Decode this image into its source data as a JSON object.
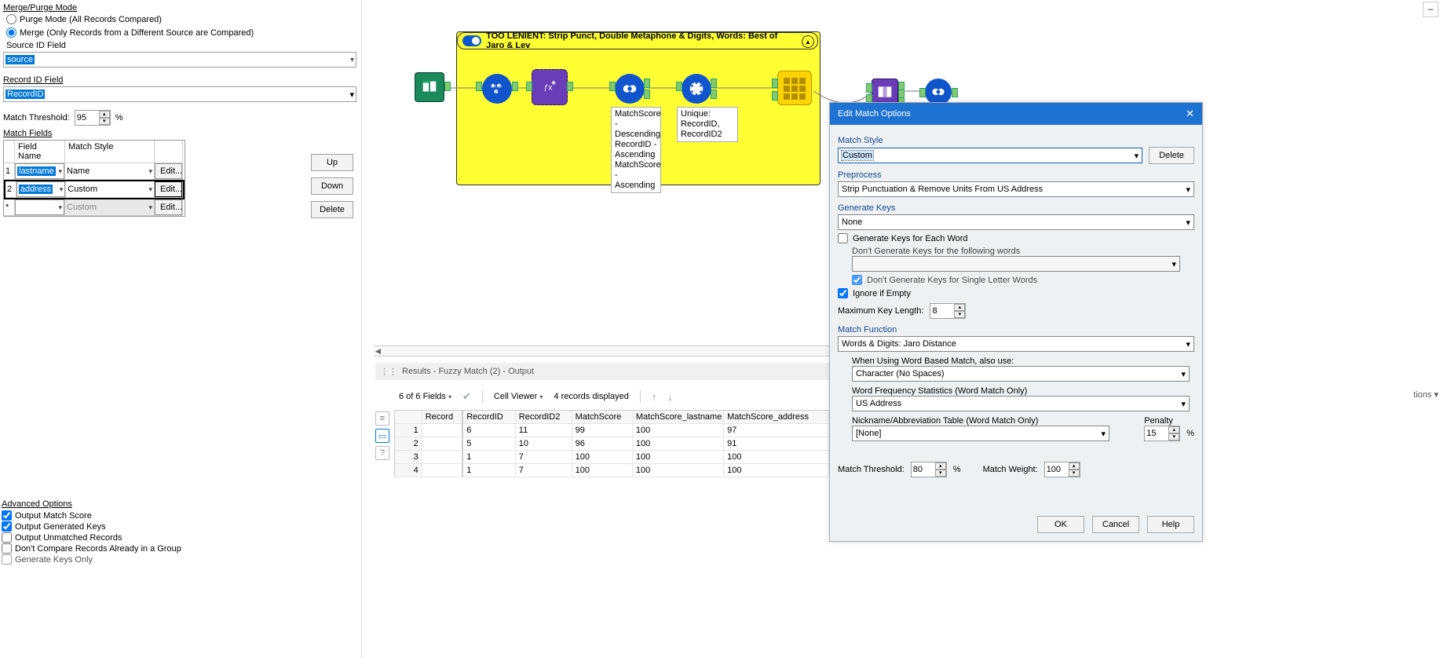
{
  "left": {
    "merge_purge_label": "Merge/Purge Mode",
    "purge_label": "Purge Mode (All Records Compared)",
    "merge_label": "Merge (Only Records from a Different Source are Compared)",
    "source_id_label": "Source ID Field",
    "source_id_value": "source",
    "record_id_label": "Record ID Field",
    "record_id_value": "RecordID",
    "thresh_label": "Match Threshold:",
    "thresh_value": "95",
    "pct": "%",
    "match_fields_label": "Match Fields",
    "headers": {
      "fname": "Field Name",
      "mstyle": "Match Style"
    },
    "rows": [
      {
        "idx": "1",
        "name": "lastname",
        "style": "Name",
        "edit": "Edit..."
      },
      {
        "idx": "2",
        "name": "address",
        "style": "Custom",
        "edit": "Edit..."
      },
      {
        "idx": "*",
        "name": "",
        "style": "Custom",
        "edit": "Edit..."
      }
    ],
    "btns": {
      "up": "Up",
      "down": "Down",
      "delete": "Delete"
    },
    "adv_label": "Advanced Options",
    "adv": {
      "out_score": "Output Match Score",
      "out_keys": "Output Generated Keys",
      "out_unmatched": "Output Unmatched Records",
      "dont_compare": "Don't Compare Records Already in a Group",
      "gen_keys_only": "Generate Keys Only"
    }
  },
  "macro_title": "TOO LENIENT: Strip Punct, Double Metaphone & Digits, Words: Best of Jaro & Lev",
  "caption_sort": "MatchScore - Descending\nRecordID - Ascending\nMatchScore - Ascending",
  "caption_unique": "Unique: RecordID, RecordID2",
  "results": {
    "title": "Results - Fuzzy Match (2) - Output",
    "fields": "6 of 6 Fields",
    "cell_viewer": "Cell Viewer",
    "records": "4 records displayed",
    "cols": [
      "Record",
      "RecordID",
      "RecordID2",
      "MatchScore",
      "MatchScore_lastname",
      "MatchScore_address"
    ],
    "rows": [
      [
        "1",
        "6",
        "11",
        "99",
        "100",
        "97"
      ],
      [
        "2",
        "5",
        "10",
        "96",
        "100",
        "91"
      ],
      [
        "3",
        "1",
        "7",
        "100",
        "100",
        "100"
      ],
      [
        "4",
        "1",
        "7",
        "100",
        "100",
        "100"
      ]
    ]
  },
  "dialog": {
    "title": "Edit Match Options",
    "match_style_label": "Match Style",
    "match_style_value": "Custom",
    "delete_btn": "Delete",
    "preprocess_label": "Preprocess",
    "preprocess_value": "Strip Punctuation & Remove Units From US Address",
    "gen_keys_label": "Generate Keys",
    "gen_keys_value": "None",
    "gen_each_word": "Generate Keys for Each Word",
    "dont_gen_words": "Don't Generate Keys for the following words",
    "dont_gen_single": "Don't Generate Keys for Single Letter Words",
    "ignore_empty": "Ignore if Empty",
    "max_key_label": "Maximum Key Length:",
    "max_key_value": "8",
    "match_fn_label": "Match Function",
    "match_fn_value": "Words & Digits: Jaro Distance",
    "word_based_label": "When Using Word Based Match, also use:",
    "word_based_value": "Character (No Spaces)",
    "word_freq_label": "Word Frequency Statistics (Word Match Only)",
    "word_freq_value": "US Address",
    "nick_label": "Nickname/Abbreviation Table (Word Match Only)",
    "nick_value": "[None]",
    "penalty_label": "Penalty",
    "penalty_value": "15",
    "thresh_label": "Match Threshold:",
    "thresh_value": "80",
    "weight_label": "Match Weight:",
    "weight_value": "100",
    "ok": "OK",
    "cancel": "Cancel",
    "help": "Help"
  },
  "far_right_cut": "tions"
}
